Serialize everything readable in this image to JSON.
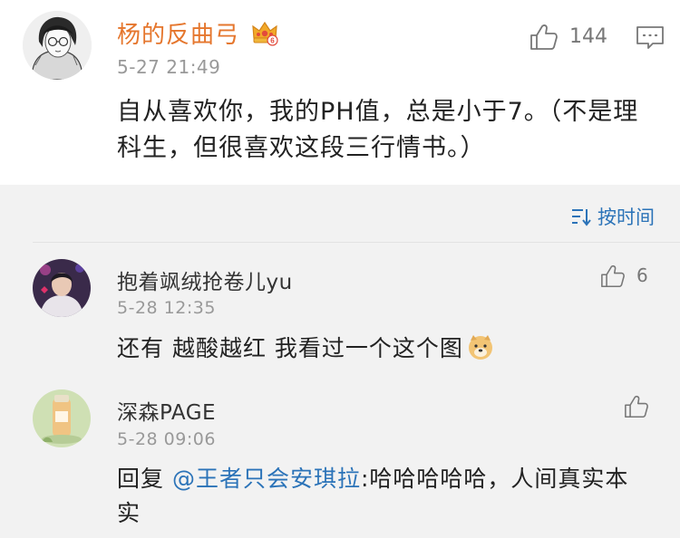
{
  "main_comment": {
    "username": "杨的反曲弓",
    "time": "5-27 21:49",
    "like_count": "144",
    "text": "自从喜欢你，我的PH值，总是小于7。（不是理科生，但很喜欢这段三行情书。）"
  },
  "sort": {
    "label": "按时间"
  },
  "replies": [
    {
      "username": "抱着飒绒抢卷儿yu",
      "time": "5-28 12:35",
      "like_count": "6",
      "text": "还有 越酸越红 我看过一个这个图",
      "emoji": "doge-emoji"
    },
    {
      "username": "深森PAGE",
      "time": "5-28 09:06",
      "like_count": "",
      "reply_prefix": "回复",
      "mention": "@王者只会安琪拉",
      "text": ":哈哈哈哈哈，人间真实本实"
    }
  ],
  "colors": {
    "username_vip": "#e5762d",
    "link": "#2b73b8",
    "secondary": "#999999",
    "replies_background": "#f2f2f2"
  }
}
